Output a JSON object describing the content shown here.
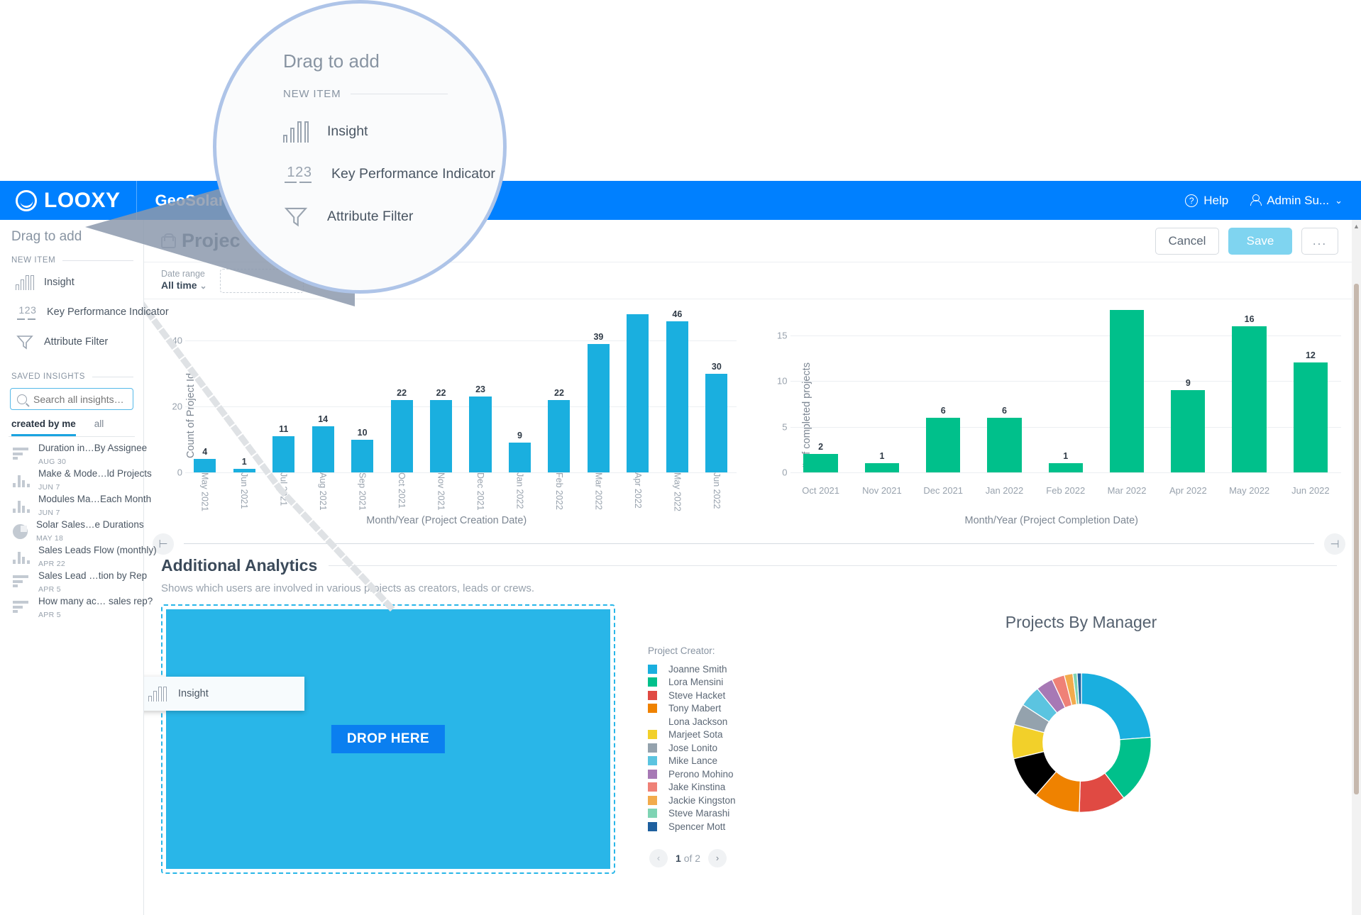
{
  "topbar": {
    "brand": "LOOXY",
    "tab": "GeoSolarmo",
    "help": "Help",
    "user": "Admin Su...",
    "chevron": "⌄"
  },
  "sidebar": {
    "drag_title": "Drag to add",
    "new_item_label": "NEW ITEM",
    "new_items": [
      {
        "label": "Insight",
        "icon": "bar-chart-icon"
      },
      {
        "label": "Key Performance Indicator",
        "icon": "kpi-123-icon"
      },
      {
        "label": "Attribute Filter",
        "icon": "funnel-icon"
      }
    ],
    "saved_label": "SAVED INSIGHTS",
    "search_placeholder": "Search all insights…",
    "tabs": [
      {
        "label": "created by me",
        "active": true
      },
      {
        "label": "all",
        "active": false
      }
    ],
    "insights": [
      {
        "title": "Duration in…By Assignee",
        "date": "AUG 30",
        "icon": "hbar"
      },
      {
        "title": "Make & Mode…ld Projects",
        "date": "JUN 7",
        "icon": "vbar"
      },
      {
        "title": "Modules Ma…Each Month",
        "date": "JUN 7",
        "icon": "vbar"
      },
      {
        "title": "Solar Sales…e Durations",
        "date": "MAY 18",
        "icon": "pie"
      },
      {
        "title": "Sales Leads Flow (monthly)",
        "date": "APR 22",
        "icon": "vbar"
      },
      {
        "title": "Sales Lead …tion by Rep",
        "date": "APR 5",
        "icon": "hbar"
      },
      {
        "title": "How many ac… sales rep?",
        "date": "APR 5",
        "icon": "hbar"
      }
    ]
  },
  "page": {
    "title": "Projec",
    "cancel": "Cancel",
    "save": "Save",
    "more": "...",
    "date_range_label": "Date range",
    "date_range_value": "All time",
    "date_range_caret": "⌄"
  },
  "analytics": {
    "section_title": "Additional Analytics",
    "section_sub": "Shows which users are involved in various projects as creators, leads or crews.",
    "drop_here": "DROP HERE",
    "drag_chip_label": "Insight",
    "handle_left": "⊢",
    "handle_right": "⊣"
  },
  "legend": {
    "title": "Project Creator:",
    "entries": [
      {
        "name": "Joanne Smith",
        "color": "#1aafdf"
      },
      {
        "name": "Lora Mensini",
        "color": "#00c08b"
      },
      {
        "name": "Steve Hacket",
        "color": "#e04a43"
      },
      {
        "name": "Tony Mabert",
        "color": "#ef8200"
      },
      {
        "name": "Lona Jackson",
        "color": "#a martin"
      },
      {
        "name": "Marjeet Sota",
        "color": "#f2d02a"
      },
      {
        "name": "Jose Lonito",
        "color": "#94a2ad"
      },
      {
        "name": "Mike Lance",
        "color": "#5bc4e0"
      },
      {
        "name": "Perono Mohino",
        "color": "#a779b5"
      },
      {
        "name": "Jake Kinstina",
        "color": "#ef8177"
      },
      {
        "name": "Jackie Kingston",
        "color": "#f2ab4c"
      },
      {
        "name": "Steve Marashi",
        "color": "#7fd4b4"
      },
      {
        "name": "Spencer Mott",
        "color": "#1e5f9e"
      }
    ],
    "page_current": "1",
    "page_of": "of 2",
    "prev": "‹",
    "next": "›"
  },
  "chart_data": [
    {
      "type": "bar",
      "title": "",
      "xlabel": "Month/Year (Project Creation Date)",
      "ylabel": "Count of Project Id",
      "ylim": [
        0,
        50
      ],
      "yticks": [
        0,
        20,
        40
      ],
      "color": "#1aafdf",
      "categories": [
        "May 2021",
        "Jun 2021",
        "Jul 2021",
        "Aug 2021",
        "Sep 2021",
        "Oct 2021",
        "Nov 2021",
        "Dec 2021",
        "Jan 2022",
        "Feb 2022",
        "Mar 2022",
        "Apr 2022",
        "May 2022",
        "Jun 2022"
      ],
      "values": [
        4,
        1,
        11,
        14,
        10,
        22,
        22,
        23,
        9,
        22,
        39,
        48,
        46,
        30
      ],
      "labels": [
        "4",
        "1",
        "11",
        "14",
        "10",
        "22",
        "22",
        "23",
        "9",
        "22",
        "39",
        "",
        "46",
        "30"
      ]
    },
    {
      "type": "bar",
      "title": "",
      "xlabel": "Month/Year (Project Completion Date)",
      "ylabel": "# of completed projects",
      "ylim": [
        0,
        18
      ],
      "yticks": [
        0,
        5,
        10,
        15
      ],
      "color": "#00c08b",
      "categories": [
        "Oct 2021",
        "Nov 2021",
        "Dec 2021",
        "Jan 2022",
        "Feb 2022",
        "Mar 2022",
        "Apr 2022",
        "May 2022",
        "Jun 2022"
      ],
      "values": [
        2,
        1,
        6,
        6,
        1,
        18,
        9,
        16,
        12
      ],
      "labels": [
        "2",
        "1",
        "6",
        "6",
        "1",
        "",
        "9",
        "16",
        "12"
      ]
    },
    {
      "type": "pie",
      "title": "Projects By Manager",
      "labels": [
        "Joanne Smith",
        "Lora Mensini",
        "Steve Hacket",
        "Tony Mabert",
        "Lona Jackson",
        "Marjeet Sota",
        "Jose Lonito",
        "Mike Lance",
        "Perono Mohino",
        "Jake Kinstina",
        "Jackie Kingston",
        "Steve Marashi",
        "Spencer Mott"
      ],
      "values": [
        24,
        16,
        11,
        11,
        10,
        8,
        5,
        5,
        4,
        3,
        2,
        1,
        1
      ],
      "colors": [
        "#1aafdf",
        "#00c08b",
        "#e04a43",
        "#ef8200",
        "#a martin",
        "#f2d02a",
        "#94a2ad",
        "#5bc4e0",
        "#a779b5",
        "#ef8177",
        "#f2ab4c",
        "#7fd4b4",
        "#1e5f9e"
      ]
    }
  ],
  "magnifier": {
    "title": "Drag to add",
    "section": "NEW ITEM",
    "items": [
      {
        "label": "Insight"
      },
      {
        "label": "Key Performance Indicator"
      },
      {
        "label": "Attribute Filter"
      }
    ]
  }
}
